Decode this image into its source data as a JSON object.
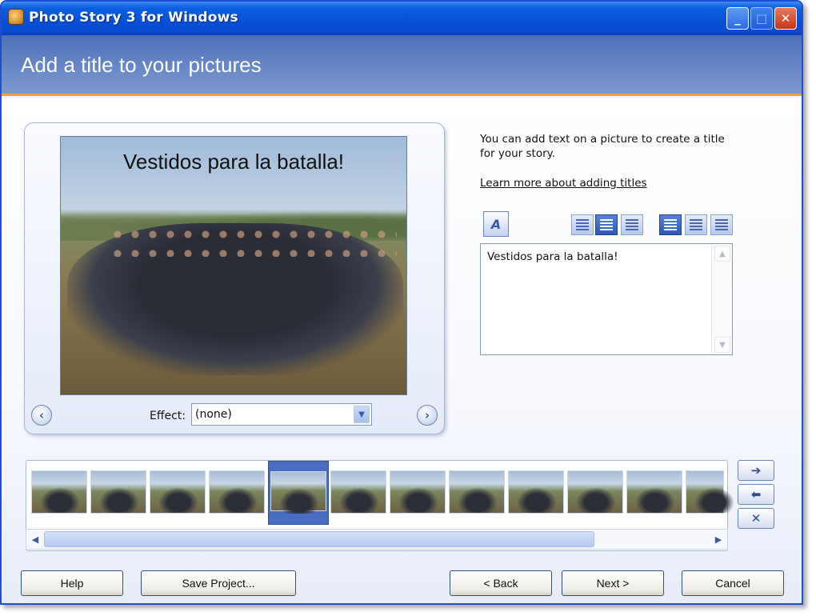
{
  "window": {
    "title": "Photo Story 3 for Windows",
    "minimize_glyph": "_",
    "maximize_glyph": "□",
    "close_glyph": "✕"
  },
  "header": {
    "title": "Add a title to your pictures"
  },
  "preview": {
    "caption": "Vestidos para la batalla!",
    "effect_label": "Effect:",
    "effect_value": "(none)",
    "prev_glyph": "‹",
    "next_glyph": "›"
  },
  "sidebar": {
    "instructions": "You can add text on a picture to create a title for your story.",
    "learn_more_link": "Learn more about adding titles",
    "font_glyph": "A"
  },
  "title_editor": {
    "text": "Vestidos para la batalla!"
  },
  "filmstrip": {
    "selected_index": 4,
    "thumb_count": 12,
    "move_right_glyph": "➔",
    "move_left_glyph": "⬅",
    "delete_glyph": "✕"
  },
  "buttons": {
    "help": "Help",
    "save_project": "Save Project...",
    "back": "< Back",
    "next": "Next >",
    "cancel": "Cancel"
  },
  "colors": {
    "titlebar": "#0550d6",
    "header": "#6a89c8",
    "accent_line": "#f0a038",
    "selected_thumb": "#4a6cc0"
  },
  "icons": [
    "app-icon",
    "font-icon",
    "align-left-icon",
    "align-center-icon",
    "align-right-icon",
    "valign-top-icon",
    "valign-middle-icon",
    "valign-bottom-icon",
    "arrow-right-icon",
    "arrow-left-icon",
    "delete-icon"
  ]
}
